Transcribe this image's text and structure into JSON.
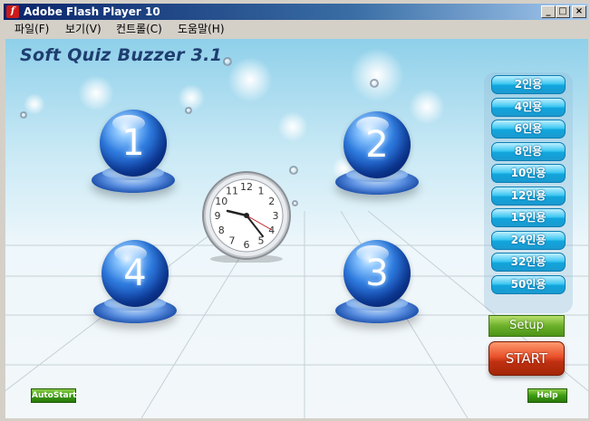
{
  "window": {
    "title": "Adobe Flash Player 10"
  },
  "menu": [
    "파일(F)",
    "보기(V)",
    "컨트롤(C)",
    "도움말(H)"
  ],
  "app_title": "Soft Quiz Buzzer 3.1",
  "buzzers": [
    "1",
    "2",
    "4",
    "3"
  ],
  "clock": {
    "numerals": [
      "12",
      "1",
      "2",
      "3",
      "4",
      "5",
      "6",
      "7",
      "8",
      "9",
      "10",
      "11"
    ]
  },
  "player_counts": [
    "2인용",
    "4인용",
    "6인용",
    "8인용",
    "10인용",
    "12인용",
    "15인용",
    "24인용",
    "32인용",
    "50인용"
  ],
  "setup_label": "Setup",
  "start_label": "START",
  "autostart_label": "AutoStart",
  "help_label": "Help",
  "colors": {
    "titlebar": "#0a246a",
    "buzzer_blue": "#1248b0",
    "count_button": "#1aa8e0",
    "setup_green": "#6cb02a",
    "start_red": "#d8401c"
  }
}
